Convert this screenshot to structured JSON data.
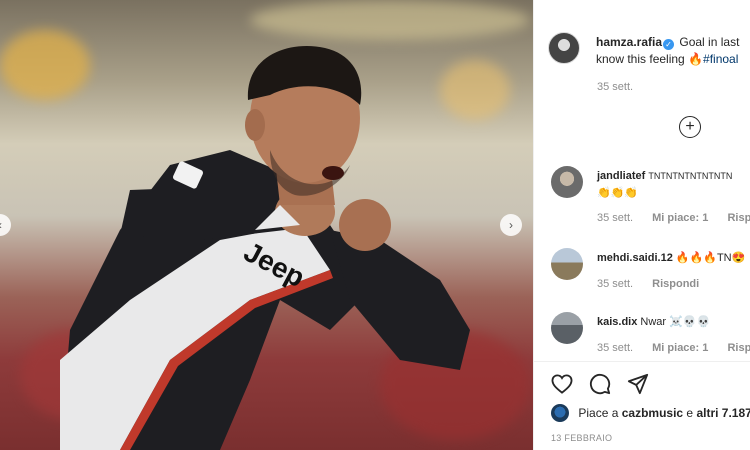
{
  "post": {
    "username": "hamza.rafia",
    "verified_mark": "✓",
    "caption": "Goal in last",
    "caption_line2": "know this feeling",
    "caption_emoji": "🔥",
    "hashtag": "#finoal",
    "time": "35 sett.",
    "more_comments_icon": "+"
  },
  "media": {
    "prev_icon": "‹",
    "next_icon": "›",
    "jersey_text": "Jeep"
  },
  "comments": [
    {
      "username": "jandliatef",
      "text": "TNTNTNTNTNTNTN",
      "text_line2": "👏👏👏",
      "time": "35 sett.",
      "likes": "Mi piace: 1",
      "reply": "Rispondi"
    },
    {
      "username": "mehdi.saidi.12",
      "text": "🔥🔥🔥TN😍",
      "time": "35 sett.",
      "reply": "Rispondi"
    },
    {
      "username": "kais.dix",
      "text": "Nwar ☠️💀💀",
      "time": "35 sett.",
      "likes": "Mi piace: 1",
      "reply": "Rispondi"
    }
  ],
  "footer": {
    "likes_prefix": "Piace a",
    "likes_user": "cazbmusic",
    "likes_and": "e",
    "likes_others": "altri 7.187",
    "date": "13 FEBBRAIO"
  },
  "icons": {
    "like": "heart-icon",
    "comment": "comment-icon",
    "share": "share-icon"
  },
  "colors": {
    "accent": "#3897f0",
    "link": "#00376b",
    "muted": "#8e8e8e"
  }
}
